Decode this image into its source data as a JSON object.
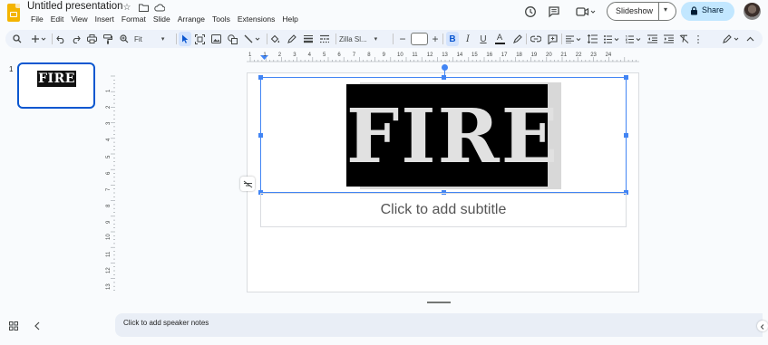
{
  "app": {
    "title": "Untitled presentation",
    "menu": [
      "File",
      "Edit",
      "View",
      "Insert",
      "Format",
      "Slide",
      "Arrange",
      "Tools",
      "Extensions",
      "Help"
    ]
  },
  "header": {
    "slideshow_label": "Slideshow",
    "share_label": "Share"
  },
  "toolbar": {
    "zoom": "Fit",
    "font": "Zilla Sl...",
    "font_size": ""
  },
  "filmstrip": {
    "slides": [
      {
        "number": "1",
        "thumb_text": "FIRE"
      }
    ]
  },
  "ruler": {
    "horizontal": [
      "1",
      "1",
      "2",
      "3",
      "4",
      "5",
      "6",
      "7",
      "8",
      "9",
      "10",
      "11",
      "12",
      "13",
      "14",
      "15",
      "16",
      "17",
      "18",
      "19",
      "20",
      "21",
      "22",
      "23",
      "24"
    ],
    "vertical": [
      "1",
      "2",
      "3",
      "4",
      "5",
      "6",
      "7",
      "8",
      "9",
      "10",
      "11",
      "12",
      "13"
    ]
  },
  "slide": {
    "title_text": "FIRE",
    "subtitle_placeholder": "Click to add subtitle"
  },
  "notes": {
    "placeholder": "Click to add speaker notes"
  },
  "colors": {
    "accent_blue": "#0b57d0",
    "selection_blue": "#4285f4",
    "share_bg": "#c2e7ff",
    "toolbar_bg": "#edf2fa"
  }
}
